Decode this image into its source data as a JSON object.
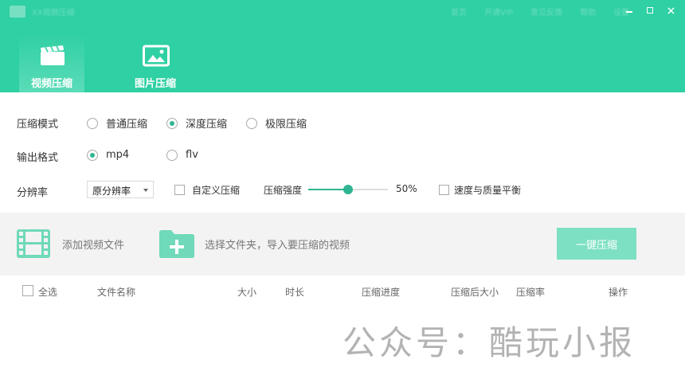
{
  "window": {
    "title": "XX视频压缩",
    "top_menu": [
      "首页",
      "开通VIP",
      "意见反馈",
      "帮助",
      "设置"
    ]
  },
  "tabs": [
    {
      "label": "视频压缩",
      "active": true,
      "icon": "clapperboard-icon"
    },
    {
      "label": "图片压缩",
      "active": false,
      "icon": "image-icon"
    }
  ],
  "settings": {
    "mode": {
      "label": "压缩模式",
      "options": [
        "普通压缩",
        "深度压缩",
        "极限压缩"
      ],
      "selected": "深度压缩"
    },
    "format": {
      "label": "输出格式",
      "options": [
        "mp4",
        "flv"
      ],
      "selected": "mp4"
    },
    "resolution": {
      "label": "分辨率",
      "value": "原分辨率"
    },
    "custom_compress": {
      "label": "自定义压缩",
      "checked": false
    },
    "strength": {
      "label": "压缩强度",
      "value_text": "50%",
      "value": 0.5
    },
    "balance": {
      "label": "速度与质量平衡",
      "checked": false
    }
  },
  "actions": {
    "add_video": "添加视频文件",
    "add_folder": "选择文件夹，导入要压缩的视频",
    "compress_button": "一键压缩"
  },
  "table": {
    "select_all": "全选",
    "columns": [
      "文件名称",
      "大小",
      "时长",
      "压缩进度",
      "压缩后大小",
      "压缩率",
      "操作"
    ]
  },
  "watermark": "公众号：酷玩小报",
  "colors": {
    "accent": "#2fd0a3",
    "accent_dark": "#2fb592",
    "button_disabled": "#7de0c3"
  }
}
